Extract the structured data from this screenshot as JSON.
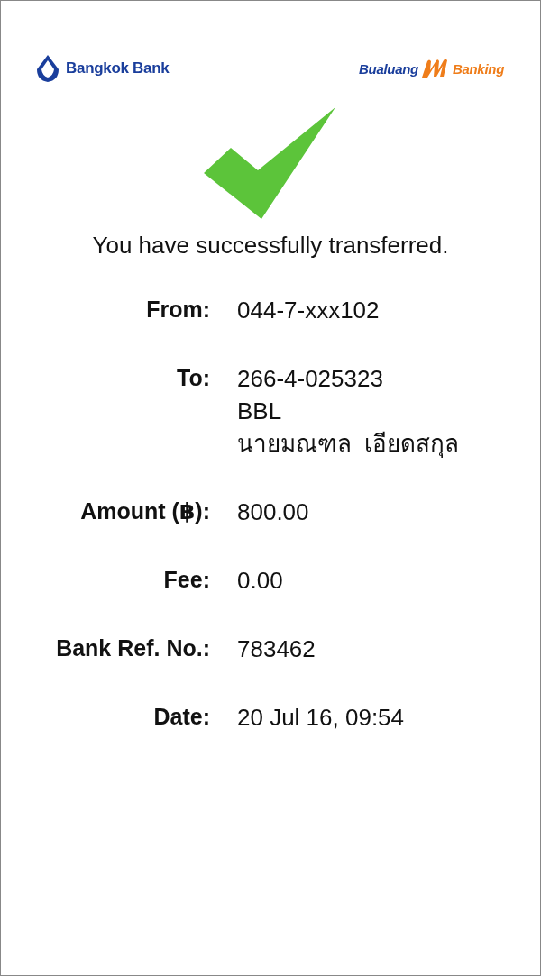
{
  "header": {
    "bank_name": "Bangkok Bank",
    "app_name_left": "Bualuang",
    "app_name_right": "Banking"
  },
  "message": "You have successfully transferred.",
  "details": [
    {
      "label": "From:",
      "lines": [
        "044-7-xxx102"
      ]
    },
    {
      "label": "To:",
      "lines": [
        "266-4-025323",
        "BBL",
        "นายมณฑล  เอียดสกุล"
      ]
    },
    {
      "label": "Amount (฿):",
      "lines": [
        "800.00"
      ]
    },
    {
      "label": "Fee:",
      "lines": [
        "0.00"
      ]
    },
    {
      "label": "Bank Ref. No.:",
      "lines": [
        "783462"
      ]
    },
    {
      "label": "Date:",
      "lines": [
        "20 Jul 16, 09:54"
      ]
    }
  ]
}
